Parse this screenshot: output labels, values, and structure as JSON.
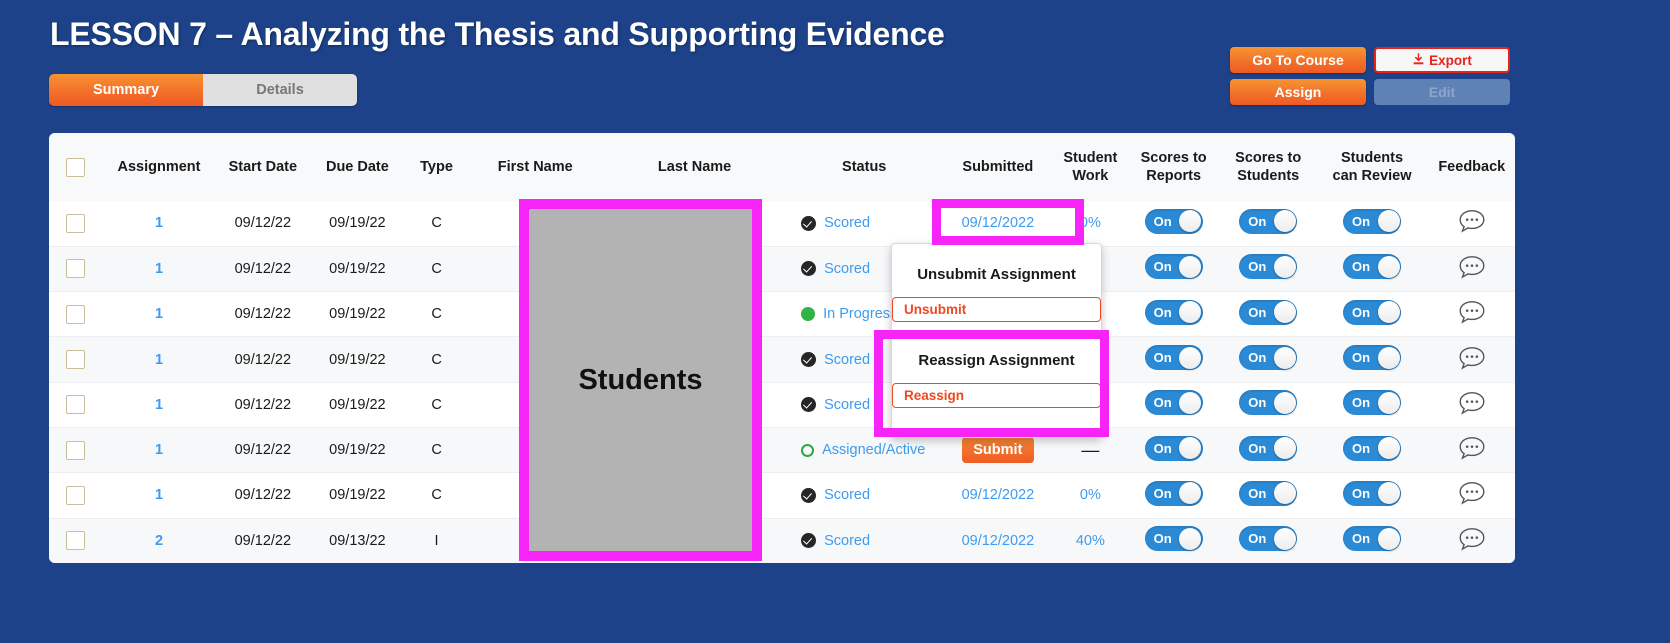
{
  "header": {
    "title": "LESSON 7 – Analyzing the Thesis and Supporting Evidence",
    "tabs": [
      {
        "label": "Summary",
        "active": true
      },
      {
        "label": "Details",
        "active": false
      }
    ],
    "buttons": {
      "go_to_course": "Go To Course",
      "assign": "Assign",
      "export": "Export",
      "edit": "Edit"
    },
    "icons": {
      "export": "download-icon"
    }
  },
  "table": {
    "columns": [
      "",
      "Assignment",
      "Start Date",
      "Due Date",
      "Type",
      "First Name",
      "Last Name",
      "Status",
      "Submitted",
      "Student Work",
      "Scores to Reports",
      "Scores to Students",
      "Students can Review",
      "Feedback"
    ],
    "column_lines": {
      "student_work": [
        "Student",
        "Work"
      ],
      "scores_reports": [
        "Scores to",
        "Reports"
      ],
      "scores_students": [
        "Scores to",
        "Students"
      ],
      "students_review": [
        "Students",
        "can Review"
      ]
    },
    "rows": [
      {
        "assignment": "1",
        "start": "09/12/22",
        "due": "09/19/22",
        "type": "C",
        "status": "Scored",
        "status_icon": "check-circle-icon",
        "submitted": "09/12/2022",
        "submitted_kind": "date",
        "work": "0%",
        "toggles": [
          "On",
          "On",
          "On"
        ],
        "feedback": "comment-icon"
      },
      {
        "assignment": "1",
        "start": "09/12/22",
        "due": "09/19/22",
        "type": "C",
        "status": "Scored",
        "status_icon": "check-circle-icon",
        "submitted": "",
        "submitted_kind": "hidden",
        "work": "",
        "toggles": [
          "On",
          "On",
          "On"
        ],
        "feedback": "comment-icon"
      },
      {
        "assignment": "1",
        "start": "09/12/22",
        "due": "09/19/22",
        "type": "C",
        "status": "In Progress",
        "status_icon": "progress-dot-icon",
        "submitted": "",
        "submitted_kind": "hidden",
        "work": "",
        "toggles": [
          "On",
          "On",
          "On"
        ],
        "feedback": "comment-icon"
      },
      {
        "assignment": "1",
        "start": "09/12/22",
        "due": "09/19/22",
        "type": "C",
        "status": "Scored",
        "status_icon": "check-circle-icon",
        "submitted": "",
        "submitted_kind": "hidden",
        "work": "",
        "toggles": [
          "On",
          "On",
          "On"
        ],
        "feedback": "comment-icon"
      },
      {
        "assignment": "1",
        "start": "09/12/22",
        "due": "09/19/22",
        "type": "C",
        "status": "Scored",
        "status_icon": "check-circle-icon",
        "submitted": "",
        "submitted_kind": "hidden",
        "work": "",
        "toggles": [
          "On",
          "On",
          "On"
        ],
        "feedback": "comment-icon"
      },
      {
        "assignment": "1",
        "start": "09/12/22",
        "due": "09/19/22",
        "type": "C",
        "status": "Assigned/Active",
        "status_icon": "circle-outline-icon",
        "submitted": "Submit",
        "submitted_kind": "button",
        "work": "—",
        "toggles": [
          "On",
          "On",
          "On"
        ],
        "feedback": "comment-icon"
      },
      {
        "assignment": "1",
        "start": "09/12/22",
        "due": "09/19/22",
        "type": "C",
        "status": "Scored",
        "status_icon": "check-circle-icon",
        "submitted": "09/12/2022",
        "submitted_kind": "date",
        "work": "0%",
        "toggles": [
          "On",
          "On",
          "On"
        ],
        "feedback": "comment-icon"
      },
      {
        "assignment": "2",
        "start": "09/12/22",
        "due": "09/13/22",
        "type": "I",
        "status": "Scored",
        "status_icon": "check-circle-icon",
        "submitted": "09/12/2022",
        "submitted_kind": "date",
        "work": "40%",
        "toggles": [
          "On",
          "On",
          "On"
        ],
        "feedback": "comment-icon"
      }
    ]
  },
  "overlays": {
    "students_mask": {
      "label": "Students"
    },
    "popup": {
      "unsubmit_title": "Unsubmit Assignment",
      "unsubmit_button": "Unsubmit",
      "reassign_title": "Reassign Assignment",
      "reassign_button": "Reassign"
    },
    "highlights": [
      "submitted-cell-highlight",
      "reassign-section-highlight"
    ]
  },
  "colors": {
    "page_background": "#1d4289",
    "accent_orange": "#ef5a23",
    "link_blue": "#3d9bf0",
    "toggle_blue": "#2b8ad6",
    "highlight_magenta": "#f724f7",
    "danger_red": "#ef4822",
    "mask_gray": "#b3b3b3"
  }
}
